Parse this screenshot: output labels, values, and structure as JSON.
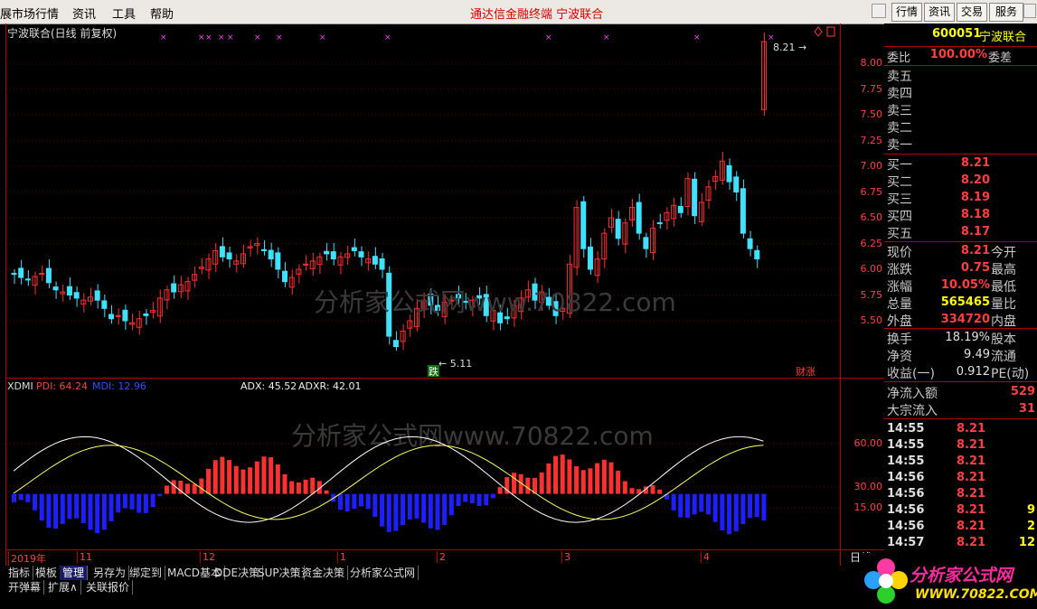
{
  "menu": {
    "items": [
      "展市场行情",
      "资讯",
      "工具",
      "帮助"
    ],
    "center_title": "通达信金融终端  宁波联合",
    "right_buttons": [
      "行情",
      "资讯",
      "交易",
      "服务"
    ]
  },
  "main_chart": {
    "title": "宁波联合(日线 前复权)",
    "high_label": "8.21",
    "low_label": "5.11",
    "fall_tag": "跌",
    "rise_tag": "财涨",
    "watermark": "分析家公式网www.70822.com",
    "price_axis": [
      "8.00",
      "7.75",
      "7.50",
      "7.25",
      "7.00",
      "6.75",
      "6.50",
      "6.25",
      "6.00",
      "5.75",
      "5.50"
    ]
  },
  "indicator": {
    "name": "XDMI",
    "pdi": "PDI: 64.24",
    "mdi": "MDI: 12.96",
    "adx": "ADX: 45.52",
    "adxr": "ADXR: 42.01",
    "axis": [
      "60.00",
      "30.00",
      "15.00"
    ],
    "watermark": "分析家公式网www.70822.com"
  },
  "date_axis": {
    "labels": [
      "2019年",
      "11",
      "12",
      "1",
      "2",
      "3",
      "4"
    ],
    "period": "日线"
  },
  "quote": {
    "code": "600051",
    "name": "宁波联合",
    "weibi_label": "委比",
    "weibi_value": "100.00%",
    "weicha_label": "委差",
    "sell": [
      {
        "label": "卖五",
        "price": ""
      },
      {
        "label": "卖四",
        "price": ""
      },
      {
        "label": "卖三",
        "price": ""
      },
      {
        "label": "卖二",
        "price": ""
      },
      {
        "label": "卖一",
        "price": ""
      }
    ],
    "buy": [
      {
        "label": "买一",
        "price": "8.21"
      },
      {
        "label": "买二",
        "price": "8.20"
      },
      {
        "label": "买三",
        "price": "8.19"
      },
      {
        "label": "买四",
        "price": "8.18"
      },
      {
        "label": "买五",
        "price": "8.17"
      }
    ],
    "stats": [
      {
        "label": "现价",
        "value": "8.21",
        "right": "今开",
        "color": "#ff4040"
      },
      {
        "label": "涨跌",
        "value": "0.75",
        "right": "最高",
        "color": "#ff4040"
      },
      {
        "label": "涨幅",
        "value": "10.05%",
        "right": "最低",
        "color": "#ff4040"
      },
      {
        "label": "总量",
        "value": "565465",
        "right": "量比",
        "color": "#ffff00"
      },
      {
        "label": "外盘",
        "value": "334720",
        "right": "内盘",
        "color": "#ff4040"
      }
    ],
    "stats2": [
      {
        "label": "换手",
        "value": "18.19%",
        "right": "股本",
        "color": "#e0e0e0"
      },
      {
        "label": "净资",
        "value": "9.49",
        "right": "流通",
        "color": "#e0e0e0"
      },
      {
        "label": "收益(一)",
        "value": "0.912",
        "right": "PE(动)",
        "color": "#e0e0e0"
      }
    ],
    "flow": [
      {
        "label": "净流入额",
        "value": "529"
      },
      {
        "label": "大宗流入",
        "value": "31"
      }
    ],
    "ticks": [
      {
        "time": "14:55",
        "price": "8.21",
        "vol": ""
      },
      {
        "time": "14:55",
        "price": "8.21",
        "vol": ""
      },
      {
        "time": "14:55",
        "price": "8.21",
        "vol": ""
      },
      {
        "time": "14:56",
        "price": "8.21",
        "vol": ""
      },
      {
        "time": "14:56",
        "price": "8.21",
        "vol": ""
      },
      {
        "time": "14:56",
        "price": "8.21",
        "vol": "9"
      },
      {
        "time": "14:56",
        "price": "8.21",
        "vol": "2"
      },
      {
        "time": "14:57",
        "price": "8.21",
        "vol": "12"
      }
    ]
  },
  "tabs_row1": [
    "指标",
    "模板",
    "管理",
    "另存为",
    "绑定到",
    "MACD基本",
    "DDE决策",
    "SUP决策",
    "资金决策",
    "分析家公式网"
  ],
  "tabs_row2": [
    "开弹幕",
    "扩展∧",
    "关联报价"
  ],
  "logo": {
    "text": "分析家公式网",
    "url": "WWW.70822.COM"
  },
  "colors": {
    "up": "#ff3030",
    "down": "#40e0ff",
    "axis": "#b00000",
    "yellow": "#ffff00",
    "mdi": "#1e1eff"
  }
}
